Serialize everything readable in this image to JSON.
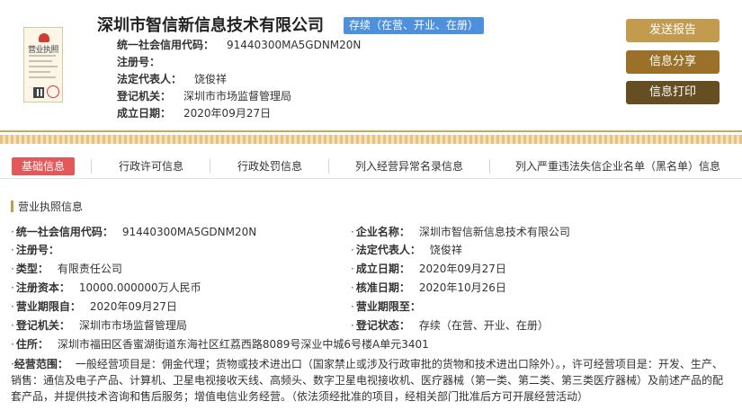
{
  "header": {
    "license_thumb": {
      "title": "营业执照"
    },
    "company_name": "深圳市智信新信息技术有限公司",
    "status_badge": "存续（在营、开业、在册）",
    "rows": [
      {
        "label": "统一社会信用代码：",
        "value": "91440300MA5GDNM20N"
      },
      {
        "label": "注册号：",
        "value": ""
      },
      {
        "label": "法定代表人：",
        "value": "饶俊祥"
      },
      {
        "label": "登记机关：",
        "value": "深圳市市场监督管理局"
      },
      {
        "label": "成立日期：",
        "value": "2020年09月27日"
      }
    ],
    "buttons": {
      "send": "发送报告",
      "share": "信息分享",
      "print": "信息打印"
    }
  },
  "tabs": [
    {
      "label": "基础信息",
      "active": true
    },
    {
      "label": "行政许可信息",
      "active": false
    },
    {
      "label": "行政处罚信息",
      "active": false
    },
    {
      "label": "列入经营异常名录信息",
      "active": false
    },
    {
      "label": "列入严重违法失信企业名单（黑名单）信息",
      "active": false
    }
  ],
  "section": {
    "title": "营业执照信息",
    "left_fields": [
      {
        "label": "统一社会信用代码：",
        "value": "91440300MA5GDNM20N"
      },
      {
        "label": "注册号：",
        "value": ""
      },
      {
        "label": "类型：",
        "value": "有限责任公司"
      },
      {
        "label": "注册资本：",
        "value": "10000.000000万人民币"
      },
      {
        "label": "营业期限自：",
        "value": "2020年09月27日"
      },
      {
        "label": "登记机关：",
        "value": "深圳市市场监督管理局"
      }
    ],
    "right_fields": [
      {
        "label": "企业名称：",
        "value": "深圳市智信新信息技术有限公司"
      },
      {
        "label": "法定代表人：",
        "value": "饶俊祥"
      },
      {
        "label": "成立日期：",
        "value": "2020年09月27日"
      },
      {
        "label": "核准日期：",
        "value": "2020年10月26日"
      },
      {
        "label": "营业期限至：",
        "value": ""
      },
      {
        "label": "登记状态：",
        "value": "存续（在营、开业、在册）"
      }
    ],
    "address": {
      "label": "住所：",
      "value": "深圳市福田区香蜜湖街道东海社区红荔西路8089号深业中城6号楼A单元3401"
    },
    "scope": {
      "label": "经营范围：",
      "value": "一般经营项目是：佣金代理；货物或技术进出口（国家禁止或涉及行政审批的货物和技术进出口除外）。，许可经营项目是：开发、生产、销售：通信及电子产品、计算机、卫星电视接收天线、高频头、数字卫星电视接收机、医疗器械（第一类、第二类、第三类医疗器械）及前述产品的配套产品，并提供技术咨询和售后服务；增值电信业务经营。（依法须经批准的项目，经相关部门批准后方可开展经营活动）"
    }
  },
  "colors": {
    "accent_gold": "#c39b4f",
    "accent_brown": "#9b7129",
    "accent_dark": "#654e22",
    "tab_active": "#e4585a",
    "status_blue": "#4d90dc"
  }
}
